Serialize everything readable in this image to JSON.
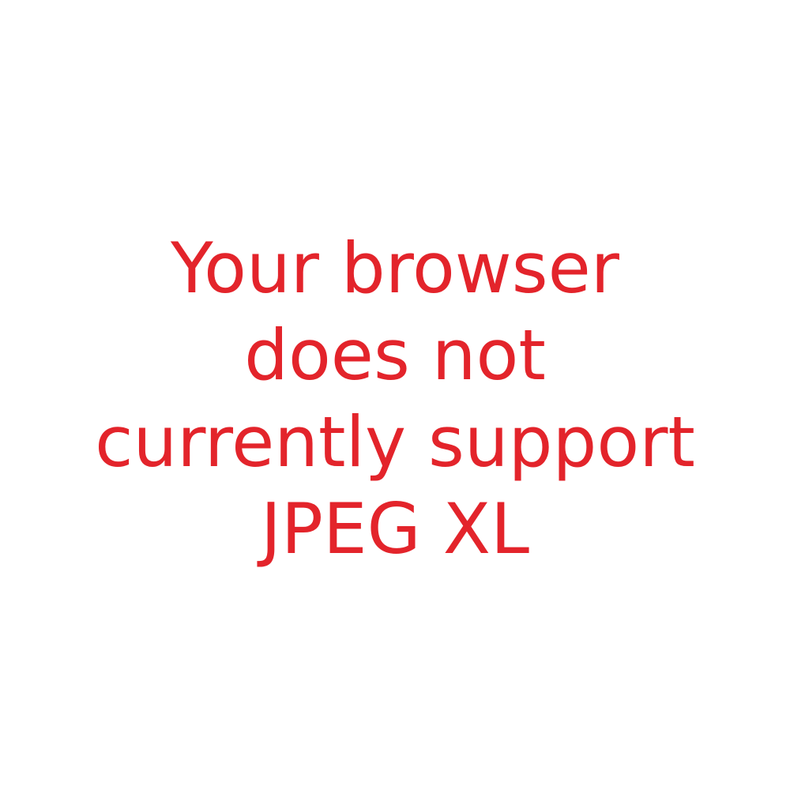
{
  "message": {
    "lines": [
      "Your browser",
      "does not",
      "currently support",
      "JPEG XL"
    ],
    "color": "#e3242b"
  },
  "background": "#ffffff"
}
